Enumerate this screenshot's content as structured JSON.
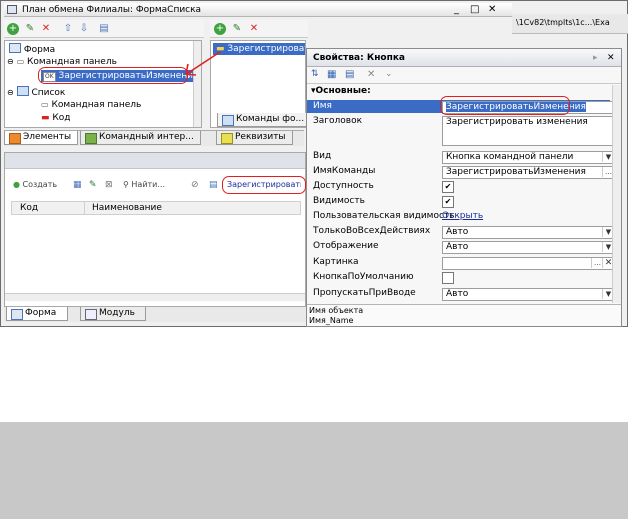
{
  "window": {
    "title": "План обмена Филиалы: ФормаСписка",
    "path_text": "\\1Cv82\\tmplts\\1c...\\Exa"
  },
  "tree": {
    "items": [
      {
        "label": "Форма"
      },
      {
        "label": "Командная панель"
      },
      {
        "label": "ЗарегистрироватьИзменения"
      },
      {
        "label": "Список"
      },
      {
        "label": "Командная панель"
      },
      {
        "label": "Код"
      }
    ]
  },
  "commands_pane": {
    "item": "Зарегистрировать",
    "tab_label": "Команды фо..."
  },
  "left_tabs": {
    "elements": "Элементы",
    "command_interface": "Командный интер...",
    "requisites": "Реквизиты"
  },
  "preview": {
    "toolbar": {
      "create": "Создать",
      "find": "Найти...",
      "register": "Зарегистрировать"
    },
    "columns": [
      "Код",
      "Наименование"
    ]
  },
  "bottom_tabs": {
    "form": "Форма",
    "module": "Модуль"
  },
  "properties": {
    "title": "Свойства: Кнопка",
    "section": "Основные:",
    "rows": [
      {
        "label": "Имя",
        "value": "ЗарегистрироватьИзменения"
      },
      {
        "label": "Заголовок",
        "value": "Зарегистрировать изменения"
      },
      {
        "label": "Вид",
        "value": "Кнопка командной панели"
      },
      {
        "label": "ИмяКоманды",
        "value": "ЗарегистрироватьИзменения"
      },
      {
        "label": "Доступность",
        "value": "✔"
      },
      {
        "label": "Видимость",
        "value": "✔"
      },
      {
        "label": "Пользовательская видимость",
        "value": "Открыть"
      },
      {
        "label": "ТолькоВоВсехДействиях",
        "value": "Авто"
      },
      {
        "label": "Отображение",
        "value": "Авто"
      },
      {
        "label": "Картинка",
        "value": ""
      },
      {
        "label": "КнопкаПоУмолчанию",
        "value": ""
      },
      {
        "label": "ПропускатьПриВводе",
        "value": "Авто"
      }
    ],
    "footer_line1": "Имя объекта",
    "footer_line2": "Имя_Name"
  }
}
